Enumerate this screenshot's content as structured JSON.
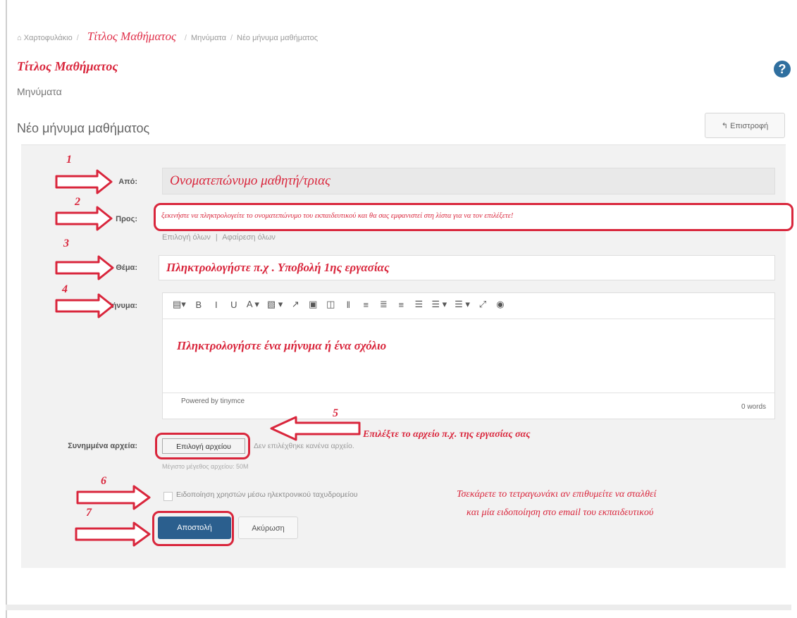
{
  "breadcrumb": {
    "home": "⌂ Χαρτοφυλάκιο",
    "course_title": "Τίτλος Μαθήματος",
    "messages": "Μηνύματα",
    "current": "Νέο μήνυμα μαθήματος"
  },
  "header": {
    "course_title": "Τίτλος Μαθήματος",
    "section": "Μηνύματα",
    "help_icon": "?",
    "page_heading": "Νέο μήνυμα μαθήματος",
    "back_button": "↰ Επιστροφή"
  },
  "form": {
    "from_label": "Από:",
    "from_value": "Ονοματεπώνυμο μαθητή/τριας",
    "to_label": "Προς:",
    "to_hint": "ξεκινήστε να πληκτρολογείτε το ονοματεπώνυμο του εκπαιδευτικού και θα σας εμφανιστεί στη λίστα για να τον επιλέξετε!",
    "select_all": "Επιλογή όλων",
    "remove_all": "Αφαίρεση όλων",
    "subject_label": "Θέμα:",
    "subject_value": "Πληκτρολογήστε π.χ . Υποβολή 1ης εργασίας",
    "message_label": "Μήνυμα:",
    "toolbar": [
      "▤▾",
      "B",
      "I",
      "U",
      "A ▾",
      "▧ ▾",
      "↗",
      "▣",
      "◫",
      "‖",
      "≡",
      "≣",
      "≡",
      "☰",
      "☰ ▾",
      "☰ ▾",
      "⤢",
      "◉"
    ],
    "message_value": "Πληκτρολογήστε ένα μήνυμα ή ένα σχόλιο",
    "powered_by": "Powered by tinymce",
    "word_count": "0 words",
    "attachments_label": "Συνημμένα αρχεία:",
    "choose_file": "Επιλογή αρχείου",
    "no_file": "Δεν επιλέχθηκε κανένα αρχείο.",
    "max_size": "Μέγιστο μέγεθος αρχείου: 50M",
    "notify_label": "Ειδοποίηση χρηστών μέσω ηλεκτρονικού ταχυδρομείου",
    "send_button": "Αποστολή",
    "cancel_button": "Ακύρωση"
  },
  "annotations": {
    "steps": [
      "1",
      "2",
      "3",
      "4",
      "5",
      "6",
      "7"
    ],
    "attach_note": "Επιλέξτε το αρχείο π.χ. της εργασίας σας",
    "notify_note_line1": "Τσεκάρετε το τετραγωνάκι αν επιθυμείτε να σταλθεί",
    "notify_note_line2": "και μία ειδοποίηση στο email του εκπαιδευτικού"
  },
  "colors": {
    "annotation_red": "#d9263c",
    "primary_button": "#2b5f8e",
    "panel_bg": "#f2f2f2"
  }
}
